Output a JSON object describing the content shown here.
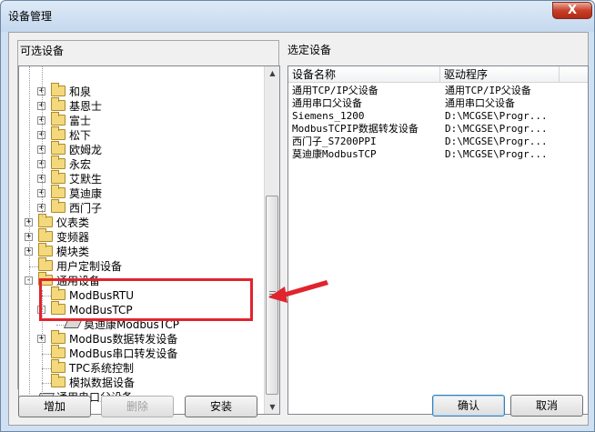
{
  "window": {
    "title": "设备管理",
    "close_label": "X"
  },
  "left_panel": {
    "title": "可选设备",
    "tree": [
      {
        "label": "和泉",
        "level": 2,
        "icon": "folder-icon",
        "expander": "+"
      },
      {
        "label": "基恩士",
        "level": 2,
        "icon": "folder-icon",
        "expander": "+"
      },
      {
        "label": "富士",
        "level": 2,
        "icon": "folder-icon",
        "expander": "+"
      },
      {
        "label": "松下",
        "level": 2,
        "icon": "folder-icon",
        "expander": "+"
      },
      {
        "label": "欧姆龙",
        "level": 2,
        "icon": "folder-icon",
        "expander": "+"
      },
      {
        "label": "永宏",
        "level": 2,
        "icon": "folder-icon",
        "expander": "+"
      },
      {
        "label": "艾默生",
        "level": 2,
        "icon": "folder-icon",
        "expander": "+"
      },
      {
        "label": "莫迪康",
        "level": 2,
        "icon": "folder-icon",
        "expander": "+"
      },
      {
        "label": "西门子",
        "level": 2,
        "icon": "folder-icon",
        "expander": "+"
      },
      {
        "label": "仪表类",
        "level": 1,
        "icon": "folder-icon",
        "expander": "+"
      },
      {
        "label": "变频器",
        "level": 1,
        "icon": "folder-icon",
        "expander": "+"
      },
      {
        "label": "模块类",
        "level": 1,
        "icon": "folder-icon",
        "expander": "+"
      },
      {
        "label": "用户定制设备",
        "level": 1,
        "icon": "folder-icon",
        "expander": ""
      },
      {
        "label": "通用设备",
        "level": 1,
        "icon": "folder-icon",
        "expander": "-"
      },
      {
        "label": "ModBusRTU",
        "level": 2,
        "icon": "folder-icon",
        "expander": ""
      },
      {
        "label": "ModBusTCP",
        "level": 2,
        "icon": "folder-icon",
        "expander": "-"
      },
      {
        "label": "莫迪康ModbusTCP",
        "level": 3,
        "icon": "device-icon",
        "expander": ""
      },
      {
        "label": "ModBus数据转发设备",
        "level": 2,
        "icon": "folder-icon",
        "expander": "+"
      },
      {
        "label": "ModBus串口转发设备",
        "level": 2,
        "icon": "folder-icon",
        "expander": ""
      },
      {
        "label": "TPC系统控制",
        "level": 2,
        "icon": "folder-icon",
        "expander": ""
      },
      {
        "label": "模拟数据设备",
        "level": 2,
        "icon": "folder-icon",
        "expander": ""
      },
      {
        "label": "通用串口父设备",
        "level": 1,
        "icon": "device-icon",
        "expander": ""
      }
    ]
  },
  "right_panel": {
    "title": "选定设备",
    "columns": [
      "设备名称",
      "驱动程序"
    ],
    "rows": [
      [
        "通用TCP/IP父设备",
        "通用TCP/IP父设备"
      ],
      [
        "通用串口父设备",
        "通用串口父设备"
      ],
      [
        "Siemens_1200",
        "D:\\MCGSE\\Progr..."
      ],
      [
        "ModbusTCPIP数据转发设备",
        "D:\\MCGSE\\Progr..."
      ],
      [
        "西门子_S7200PPI",
        "D:\\MCGSE\\Progr..."
      ],
      [
        "莫迪康ModbusTCP",
        "D:\\MCGSE\\Progr..."
      ]
    ]
  },
  "buttons": {
    "add": "增加",
    "delete": "删除",
    "install": "安装",
    "ok": "确认",
    "cancel": "取消"
  },
  "scroll": {
    "up": "▲",
    "down": "▼"
  },
  "colors": {
    "highlight": "#e0242e"
  }
}
